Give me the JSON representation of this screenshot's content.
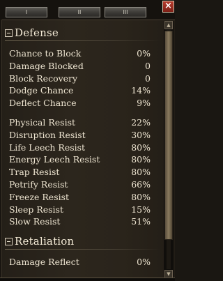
{
  "window": {
    "tabs": [
      "I",
      "II",
      "III"
    ],
    "close_label": "×"
  },
  "scrollbar": {
    "up_arrow": "▲",
    "down_arrow": "▼"
  },
  "defense": {
    "title": "Defense",
    "group1": [
      {
        "label": "Chance to Block",
        "value": "0%"
      },
      {
        "label": "Damage Blocked",
        "value": "0"
      },
      {
        "label": "Block Recovery",
        "value": "0"
      },
      {
        "label": "Dodge Chance",
        "value": "14%"
      },
      {
        "label": "Deflect Chance",
        "value": "9%"
      }
    ],
    "group2": [
      {
        "label": "Physical Resist",
        "value": "22%"
      },
      {
        "label": "Disruption Resist",
        "value": "30%"
      },
      {
        "label": "Life Leech Resist",
        "value": "80%"
      },
      {
        "label": "Energy Leech Resist",
        "value": "80%"
      },
      {
        "label": "Trap Resist",
        "value": "80%"
      },
      {
        "label": "Petrify Resist",
        "value": "66%"
      },
      {
        "label": "Freeze Resist",
        "value": "80%"
      },
      {
        "label": "Sleep Resist",
        "value": "15%"
      },
      {
        "label": "Slow Resist",
        "value": "51%"
      }
    ]
  },
  "retaliation": {
    "title": "Retaliation",
    "rows": [
      {
        "label": "Damage Reflect",
        "value": "0%"
      }
    ]
  }
}
